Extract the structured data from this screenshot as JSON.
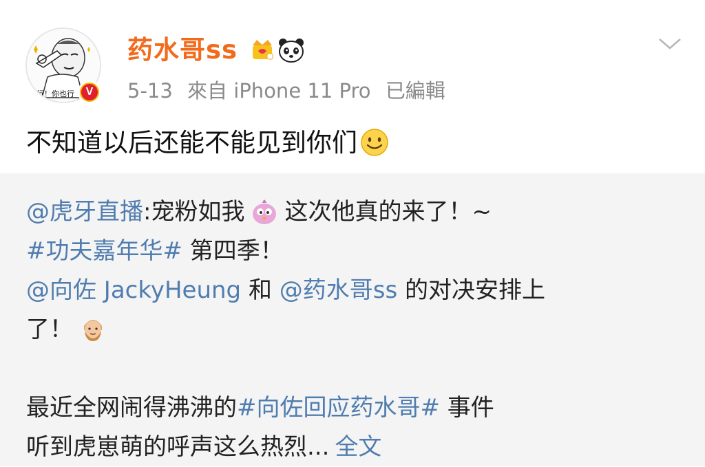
{
  "post": {
    "author_name": "药水哥ss",
    "date": "5-13",
    "source": "來自 iPhone 11 Pro",
    "edited": "已編輯",
    "text": "不知道以后还能不能见到你们",
    "avatar_caption": "行！你也行",
    "verified_mark": "V",
    "badges": [
      "crown-icon",
      "panda-icon",
      "smile-emoji"
    ]
  },
  "repost": {
    "line1": {
      "mention": "@虎牙直播",
      "text": ":宠粉如我",
      "emoji": "pink-bird-emoji",
      "text2": "这次他真的来了！~"
    },
    "line2": {
      "hashtag": "#功夫嘉年华#",
      "text": " 第四季！"
    },
    "line3": {
      "mention1": "@向佐 JackyHeung",
      "text1": " 和 ",
      "mention2": "@药水哥ss",
      "text2": " 的对决安排上"
    },
    "line4": {
      "text": "了！",
      "emoji": "bearded-man-emoji"
    },
    "line5": {
      "text1": "最近全网闹得沸沸的",
      "hashtag": "#向佐回应药水哥#",
      "text2": " 事件"
    },
    "line6": {
      "text": "听到虎崽萌的呼声这么热烈...",
      "full_text_link": "全文"
    }
  },
  "colors": {
    "author": "#f26a1b",
    "link": "#507daf",
    "meta": "#8a8a8a",
    "repost_bg": "#f4f4f4"
  }
}
